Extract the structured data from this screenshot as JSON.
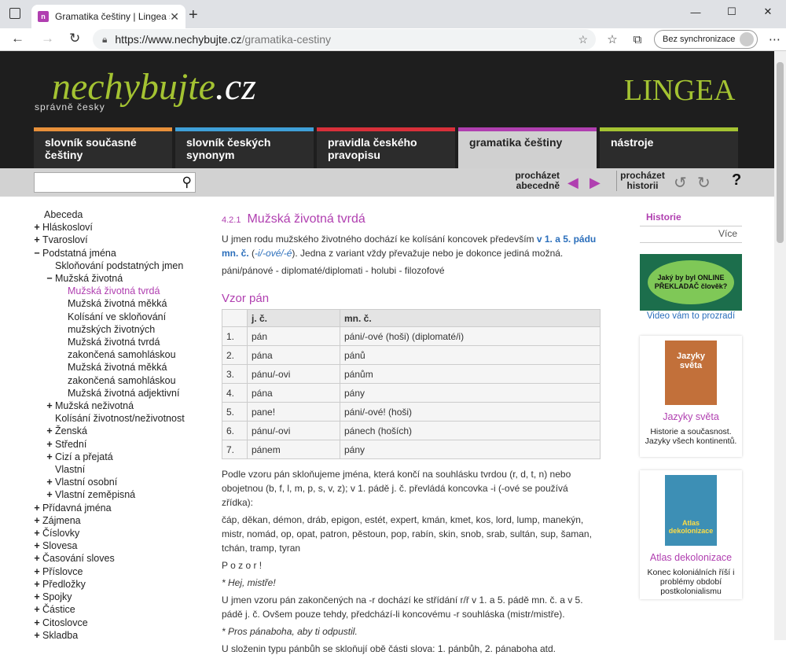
{
  "browser": {
    "tab_title": "Gramatika češtiny | Lingea s.r.o.",
    "url_host": "https://www.nechybujte.cz",
    "url_path": "/gramatika-cestiny",
    "sync_label": "Bez synchronizace"
  },
  "site": {
    "logo_main": "nechybujte",
    "logo_dot": ".",
    "logo_tld": "cz",
    "tagline": "správně česky",
    "brand": "LINGEA"
  },
  "nav_tabs": [
    {
      "label": "slovník současné češtiny",
      "color": "#e8903a"
    },
    {
      "label": "slovník českých synonym",
      "color": "#3fa0d8"
    },
    {
      "label": "pravidla českého pravopisu",
      "color": "#d8303a"
    },
    {
      "label": "gramatika češtiny",
      "color": "#b03fb0"
    },
    {
      "label": "nástroje",
      "color": "#a4c332"
    }
  ],
  "subbar": {
    "browse_abc": "procházet abecedně",
    "browse_hist": "procházet historii",
    "help": "?"
  },
  "leftnav": [
    {
      "label": "Abeceda",
      "pm": "",
      "indent": 0
    },
    {
      "label": "Hláskosloví",
      "pm": "+",
      "indent": 0
    },
    {
      "label": "Tvarosloví",
      "pm": "+",
      "indent": 0
    },
    {
      "label": "Podstatná jména",
      "pm": "−",
      "indent": 0
    },
    {
      "label": "Skloňování podstatných jmen",
      "pm": "",
      "indent": 1
    },
    {
      "label": "Mužská životná",
      "pm": "−",
      "indent": 1
    },
    {
      "label": "Mužská životná tvrdá",
      "pm": "",
      "indent": 2,
      "active": true
    },
    {
      "label": "Mužská životná měkká",
      "pm": "",
      "indent": 2
    },
    {
      "label": "Kolísání ve skloňování",
      "pm": "",
      "indent": 2
    },
    {
      "label": "mužských životných",
      "pm": "",
      "indent": 2
    },
    {
      "label": "Mužská životná tvrdá",
      "pm": "",
      "indent": 2
    },
    {
      "label": "zakončená samohláskou",
      "pm": "",
      "indent": 2
    },
    {
      "label": "Mužská životná měkká",
      "pm": "",
      "indent": 2
    },
    {
      "label": "zakončená samohláskou",
      "pm": "",
      "indent": 2
    },
    {
      "label": "Mužská životná adjektivní",
      "pm": "",
      "indent": 2
    },
    {
      "label": "Mužská neživotná",
      "pm": "+",
      "indent": 1
    },
    {
      "label": "Kolísání životnost/neživotnost",
      "pm": "",
      "indent": 1
    },
    {
      "label": "Ženská",
      "pm": "+",
      "indent": 1
    },
    {
      "label": "Střední",
      "pm": "+",
      "indent": 1
    },
    {
      "label": "Cizí a přejatá",
      "pm": "+",
      "indent": 1
    },
    {
      "label": "Vlastní",
      "pm": "",
      "indent": 1
    },
    {
      "label": "Vlastní osobní",
      "pm": "+",
      "indent": 1
    },
    {
      "label": "Vlastní zeměpisná",
      "pm": "+",
      "indent": 1
    },
    {
      "label": "Přídavná jména",
      "pm": "+",
      "indent": 0
    },
    {
      "label": "Zájmena",
      "pm": "+",
      "indent": 0
    },
    {
      "label": "Číslovky",
      "pm": "+",
      "indent": 0
    },
    {
      "label": "Slovesa",
      "pm": "+",
      "indent": 0
    },
    {
      "label": "Časování sloves",
      "pm": "+",
      "indent": 0
    },
    {
      "label": "Příslovce",
      "pm": "+",
      "indent": 0
    },
    {
      "label": "Předložky",
      "pm": "+",
      "indent": 0
    },
    {
      "label": "Spojky",
      "pm": "+",
      "indent": 0
    },
    {
      "label": "Částice",
      "pm": "+",
      "indent": 0
    },
    {
      "label": "Citoslovce",
      "pm": "+",
      "indent": 0
    },
    {
      "label": "Skladba",
      "pm": "+",
      "indent": 0
    }
  ],
  "article": {
    "section_num": "4.2.1",
    "title": "Mužská životná tvrdá",
    "intro_1": "U jmen rodu mužského životného dochází ke kolísání koncovek především ",
    "intro_hl": "v 1. a 5. pádu mn. č.",
    "intro_2": " (",
    "intro_forms": "-i/-ové/-é",
    "intro_3": "). Jedna z variant vždy převažuje nebo je dokonce jediná možná.",
    "examples": "páni/pánové - diplomaté/diplomati - holubi - filozofové",
    "vzor_title": "Vzor pán",
    "table_head": [
      "",
      "j. č.",
      "mn. č."
    ],
    "table_rows": [
      [
        "1.",
        "pán",
        "páni/-ové (hoši) (diplomaté/i)"
      ],
      [
        "2.",
        "pána",
        "pánů"
      ],
      [
        "3.",
        "pánu/-ovi",
        "pánům"
      ],
      [
        "4.",
        "pána",
        "pány"
      ],
      [
        "5.",
        "pane!",
        "páni/-ové! (hoši)"
      ],
      [
        "6.",
        "pánu/-ovi",
        "pánech (hoších)"
      ],
      [
        "7.",
        "pánem",
        "pány"
      ]
    ],
    "p1": "Podle vzoru pán skloňujeme jména, která končí na souhlásku tvrdou (r, d, t, n) nebo obojetnou (b, f, l, m, p, s, v, z); v 1. pádě j. č. převládá koncovka -i (-ové se používá zřídka):",
    "p2": "čáp, děkan, démon, dráb, epigon, estét, expert, kmán, kmet, kos, lord, lump, manekýn, mistr, nomád, op, opat, patron, pěstoun, pop, rabín, skin, snob, srab, sultán, sup, šaman, tchán, tramp, tyran",
    "pozor": "P o z o r !",
    "p3": "* Hej, mistře!",
    "p4": "U jmen vzoru pán zakončených na -r dochází ke střídání r/ř v 1. a 5. pádě mn. č. a v 5. pádě j. č. Ovšem pouze tehdy, předchází-li koncovému -r souhláska (mistr/mistře).",
    "p5": "* Pros pánaboha, aby ti odpustil.",
    "p6": "U složenin typu pánbůh se skloňují obě části slova: 1. pánbůh, 2. pánaboha atd."
  },
  "sidebar": {
    "history_title": "Historie",
    "history_more": "Více",
    "ad_text": "Jaký by byl ONLINE PŘEKLADAČ člověk?",
    "ad_caption": "Video vám to prozradí",
    "book1_cover": "Jazyky světa",
    "book1_title": "Jazyky světa",
    "book1_desc": "Historie a současnost. Jazyky všech kontinentů.",
    "book2_cover": "Atlas dekolonizace",
    "book2_title": "Atlas dekolonizace",
    "book2_desc": "Konec koloniálních říší i problémy období postkolonialismu"
  }
}
